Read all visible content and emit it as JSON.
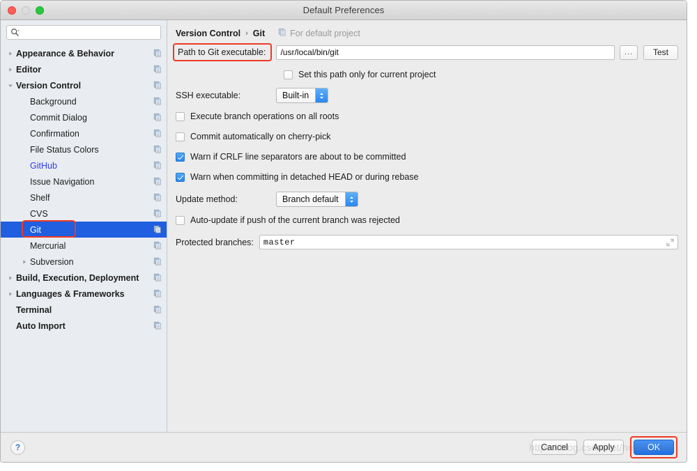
{
  "window": {
    "title": "Default Preferences",
    "traffic_lights": [
      "close-button",
      "minimize-button",
      "zoom-button"
    ]
  },
  "sidebar": {
    "search": {
      "value": "",
      "placeholder": "",
      "icon": "search-icon"
    },
    "items": [
      {
        "label": "Appearance & Behavior",
        "level": 0,
        "bold": true,
        "twisty": "collapsed",
        "link": false,
        "selected": false
      },
      {
        "label": "Editor",
        "level": 0,
        "bold": true,
        "twisty": "collapsed",
        "link": false,
        "selected": false
      },
      {
        "label": "Version Control",
        "level": 0,
        "bold": true,
        "twisty": "expanded",
        "link": false,
        "selected": false
      },
      {
        "label": "Background",
        "level": 1,
        "bold": false,
        "twisty": "none",
        "link": false,
        "selected": false
      },
      {
        "label": "Commit Dialog",
        "level": 1,
        "bold": false,
        "twisty": "none",
        "link": false,
        "selected": false
      },
      {
        "label": "Confirmation",
        "level": 1,
        "bold": false,
        "twisty": "none",
        "link": false,
        "selected": false
      },
      {
        "label": "File Status Colors",
        "level": 1,
        "bold": false,
        "twisty": "none",
        "link": false,
        "selected": false
      },
      {
        "label": "GitHub",
        "level": 1,
        "bold": false,
        "twisty": "none",
        "link": true,
        "selected": false
      },
      {
        "label": "Issue Navigation",
        "level": 1,
        "bold": false,
        "twisty": "none",
        "link": false,
        "selected": false
      },
      {
        "label": "Shelf",
        "level": 1,
        "bold": false,
        "twisty": "none",
        "link": false,
        "selected": false
      },
      {
        "label": "CVS",
        "level": 1,
        "bold": false,
        "twisty": "none",
        "link": false,
        "selected": false
      },
      {
        "label": "Git",
        "level": 1,
        "bold": false,
        "twisty": "none",
        "link": false,
        "selected": true
      },
      {
        "label": "Mercurial",
        "level": 1,
        "bold": false,
        "twisty": "none",
        "link": false,
        "selected": false
      },
      {
        "label": "Subversion",
        "level": 1,
        "bold": false,
        "twisty": "collapsed",
        "link": false,
        "selected": false
      },
      {
        "label": "Build, Execution, Deployment",
        "level": 0,
        "bold": true,
        "twisty": "collapsed",
        "link": false,
        "selected": false
      },
      {
        "label": "Languages & Frameworks",
        "level": 0,
        "bold": true,
        "twisty": "collapsed",
        "link": false,
        "selected": false
      },
      {
        "label": "Terminal",
        "level": 0,
        "bold": true,
        "twisty": "none",
        "link": false,
        "selected": false
      },
      {
        "label": "Auto Import",
        "level": 0,
        "bold": true,
        "twisty": "none",
        "link": false,
        "selected": false
      }
    ]
  },
  "main": {
    "breadcrumb": {
      "parent": "Version Control",
      "separator": "›",
      "current": "Git"
    },
    "scope_note": {
      "text": "For default project",
      "icon": "copy-icon"
    },
    "path_row": {
      "label": "Path to Git executable:",
      "value": "/usr/local/bin/git",
      "browse_label": "...",
      "test_label": "Test",
      "highlight_color": "#ee3a24"
    },
    "set_path_checkbox": {
      "label": "Set this path only for current project",
      "checked": false
    },
    "ssh_row": {
      "label": "SSH executable:",
      "value": "Built-in"
    },
    "checkboxes": [
      {
        "label": "Execute branch operations on all roots",
        "checked": false
      },
      {
        "label": "Commit automatically on cherry-pick",
        "checked": false
      },
      {
        "label": "Warn if CRLF line separators are about to be committed",
        "checked": true
      },
      {
        "label": "Warn when committing in detached HEAD or during rebase",
        "checked": true
      }
    ],
    "update_row": {
      "label": "Update method:",
      "value": "Branch default"
    },
    "autoupdate_checkbox": {
      "label": "Auto-update if push of the current branch was rejected",
      "checked": false
    },
    "protected_row": {
      "label": "Protected branches:",
      "value": "master",
      "expand_icon": "expand-icon"
    }
  },
  "footer": {
    "help_label": "?",
    "cancel_label": "Cancel",
    "apply_label": "Apply",
    "ok_label": "OK",
    "ok_highlight_color": "#ee3a24",
    "watermark": "https://blog.csdn.net/hoppy_rain"
  }
}
